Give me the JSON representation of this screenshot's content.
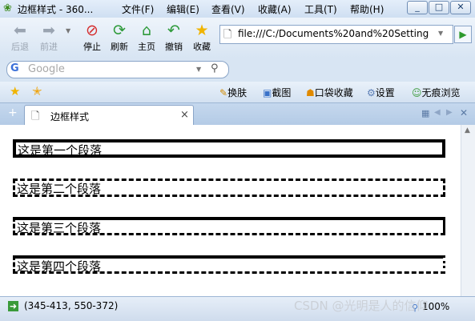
{
  "window": {
    "title": "边框样式 - 360...",
    "menus": [
      "文件(F)",
      "编辑(E)",
      "查看(V)",
      "收藏(A)",
      "工具(T)",
      "帮助(H)"
    ],
    "controls": {
      "minimize": "_",
      "maximize": "□",
      "close": "✕"
    }
  },
  "toolbar": {
    "back": "后退",
    "forward": "前进",
    "stop": "停止",
    "refresh": "刷新",
    "home": "主页",
    "undo": "撤销",
    "favorites": "收藏"
  },
  "address": {
    "value": "file:///C:/Documents%20and%20Settings"
  },
  "search": {
    "placeholder": "Google"
  },
  "favbar": {
    "items": [
      "换肤",
      "截图",
      "口袋收藏",
      "设置",
      "无痕浏览"
    ]
  },
  "tab": {
    "title": "边框样式",
    "close": "×"
  },
  "paragraphs": [
    {
      "text": "这是第一个段落",
      "border": "solid"
    },
    {
      "text": "这是第二个段落",
      "border": "dashed"
    },
    {
      "text": "这是第三个段落",
      "border": "solid-top-dashed-bottom"
    },
    {
      "text": "这是第四个段落",
      "border": "solid-top-dashed-bottom-dotted-right"
    }
  ],
  "statusbar": {
    "coords": "(345-413, 550-372)",
    "zoom": "100%",
    "watermark": "CSDN @光明是人的信仰"
  },
  "icons": [
    "back-icon",
    "forward-icon",
    "stop-icon",
    "refresh-icon",
    "home-icon",
    "undo-icon",
    "star-icon",
    "page-icon",
    "go-icon",
    "search-icon"
  ]
}
